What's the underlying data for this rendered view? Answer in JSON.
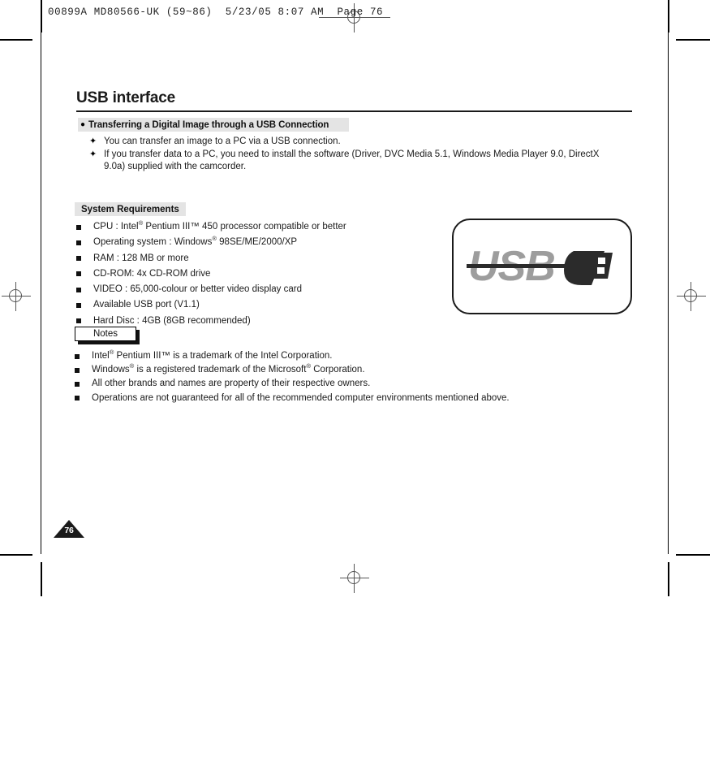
{
  "print_slug": "00899A MD80566-UK (59~86)  5/23/05 8:07 AM  Page 76",
  "page_title": "USB interface",
  "section": {
    "bullet": "●",
    "heading": "Transferring a Digital Image through a USB Connection",
    "items": [
      {
        "mark": "✦",
        "text": "You can transfer an image to a PC via a USB connection."
      },
      {
        "mark": "✦",
        "text": "If you transfer data to a PC, you need to install the software (Driver, DVC Media 5.1, Windows Media Player 9.0, DirectX 9.0a) supplied with the camcorder."
      }
    ]
  },
  "system_requirements": {
    "heading": "System Requirements",
    "items": [
      {
        "pre": "CPU : Intel",
        "sup1": "®",
        "mid": " Pentium III™ 450 processor compatible or better",
        "sup2": "",
        "post": ""
      },
      {
        "pre": "Operating system : Windows",
        "sup1": "®",
        "mid": " 98SE/ME/2000/XP",
        "sup2": "",
        "post": ""
      },
      {
        "pre": "RAM : 128 MB or more",
        "sup1": "",
        "mid": "",
        "sup2": "",
        "post": ""
      },
      {
        "pre": "CD-ROM: 4x CD-ROM drive",
        "sup1": "",
        "mid": "",
        "sup2": "",
        "post": ""
      },
      {
        "pre": "VIDEO : 65,000-colour or better video display card",
        "sup1": "",
        "mid": "",
        "sup2": "",
        "post": ""
      },
      {
        "pre": "Available USB port (V1.1)",
        "sup1": "",
        "mid": "",
        "sup2": "",
        "post": ""
      },
      {
        "pre": "Hard Disc : 4GB (8GB recommended)",
        "sup1": "",
        "mid": "",
        "sup2": "",
        "post": ""
      }
    ]
  },
  "notes": {
    "heading": "Notes",
    "items": [
      {
        "pre": "Intel",
        "sup1": "®",
        "mid": " Pentium III™ is a trademark of the Intel Corporation.",
        "sup2": "",
        "post": ""
      },
      {
        "pre": "Windows",
        "sup1": "®",
        "mid": " is a registered trademark of the Microsoft",
        "sup2": "®",
        "post": " Corporation."
      },
      {
        "pre": "All other brands and names are property of their respective owners.",
        "sup1": "",
        "mid": "",
        "sup2": "",
        "post": ""
      },
      {
        "pre": "Operations are not guaranteed for all of the recommended computer environments mentioned above.",
        "sup1": "",
        "mid": "",
        "sup2": "",
        "post": ""
      }
    ]
  },
  "usb_logo": {
    "wordmark": "USB",
    "alt": "usb-logo"
  },
  "page_number": "76",
  "colors": {
    "band_gray": "#e4e4e4",
    "text_black": "#1a1a1a",
    "logo_gray": "#9d9d9d",
    "logo_dark": "#2b2b2b"
  }
}
